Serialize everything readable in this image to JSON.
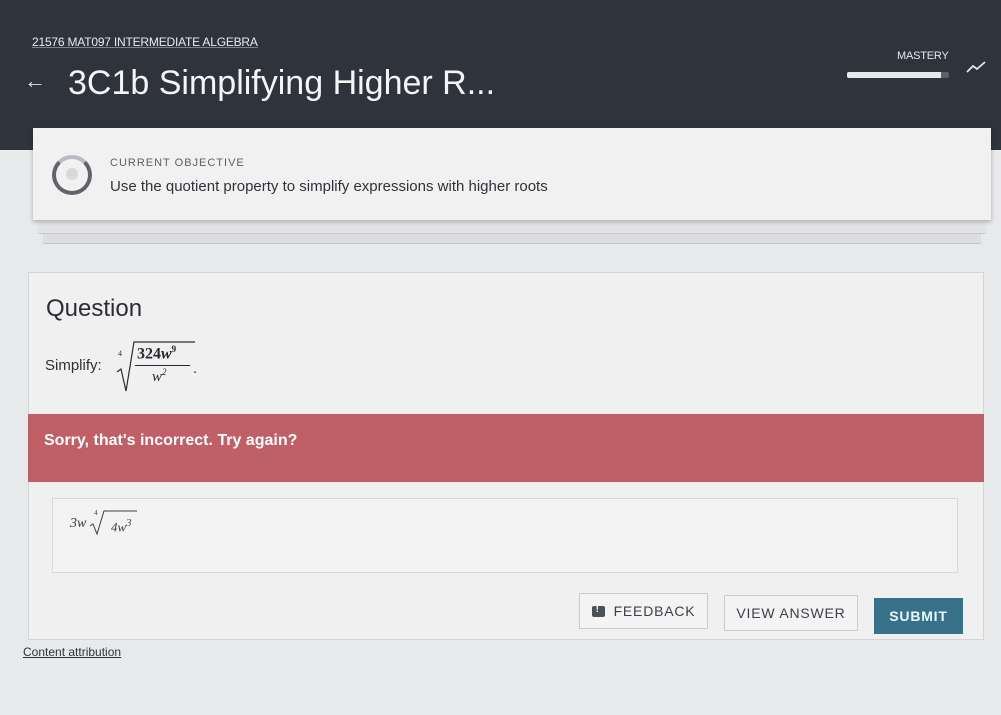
{
  "header": {
    "course": "21576 MAT097 INTERMEDIATE ALGEBRA",
    "title": "3C1b Simplifying Higher R...",
    "back_icon": "arrow-left-icon",
    "mastery_label": "MASTERY",
    "mastery_progress": 0.92,
    "trend_icon": "trend-line-icon"
  },
  "objective": {
    "label": "CURRENT OBJECTIVE",
    "text": "Use the quotient property to simplify expressions with higher roots"
  },
  "question": {
    "heading": "Question",
    "prompt": "Simplify:",
    "radical_index": "4",
    "numerator_coef": "324",
    "numerator_var": "w",
    "numerator_exp": "9",
    "denominator_var": "w",
    "denominator_exp": "2",
    "period": "."
  },
  "feedback": {
    "message": "Sorry, that's incorrect. Try again?"
  },
  "answer": {
    "coef": "3w",
    "radical_index": "4",
    "radicand_coef": "4w",
    "radicand_exp": "3"
  },
  "buttons": {
    "feedback": "FEEDBACK",
    "view_answer": "VIEW ANSWER",
    "submit": "SUBMIT"
  },
  "footer": {
    "attribution": "Content attribution"
  },
  "colors": {
    "header_bg": "#2f333b",
    "error": "#c05f66",
    "submit": "#38728a"
  }
}
